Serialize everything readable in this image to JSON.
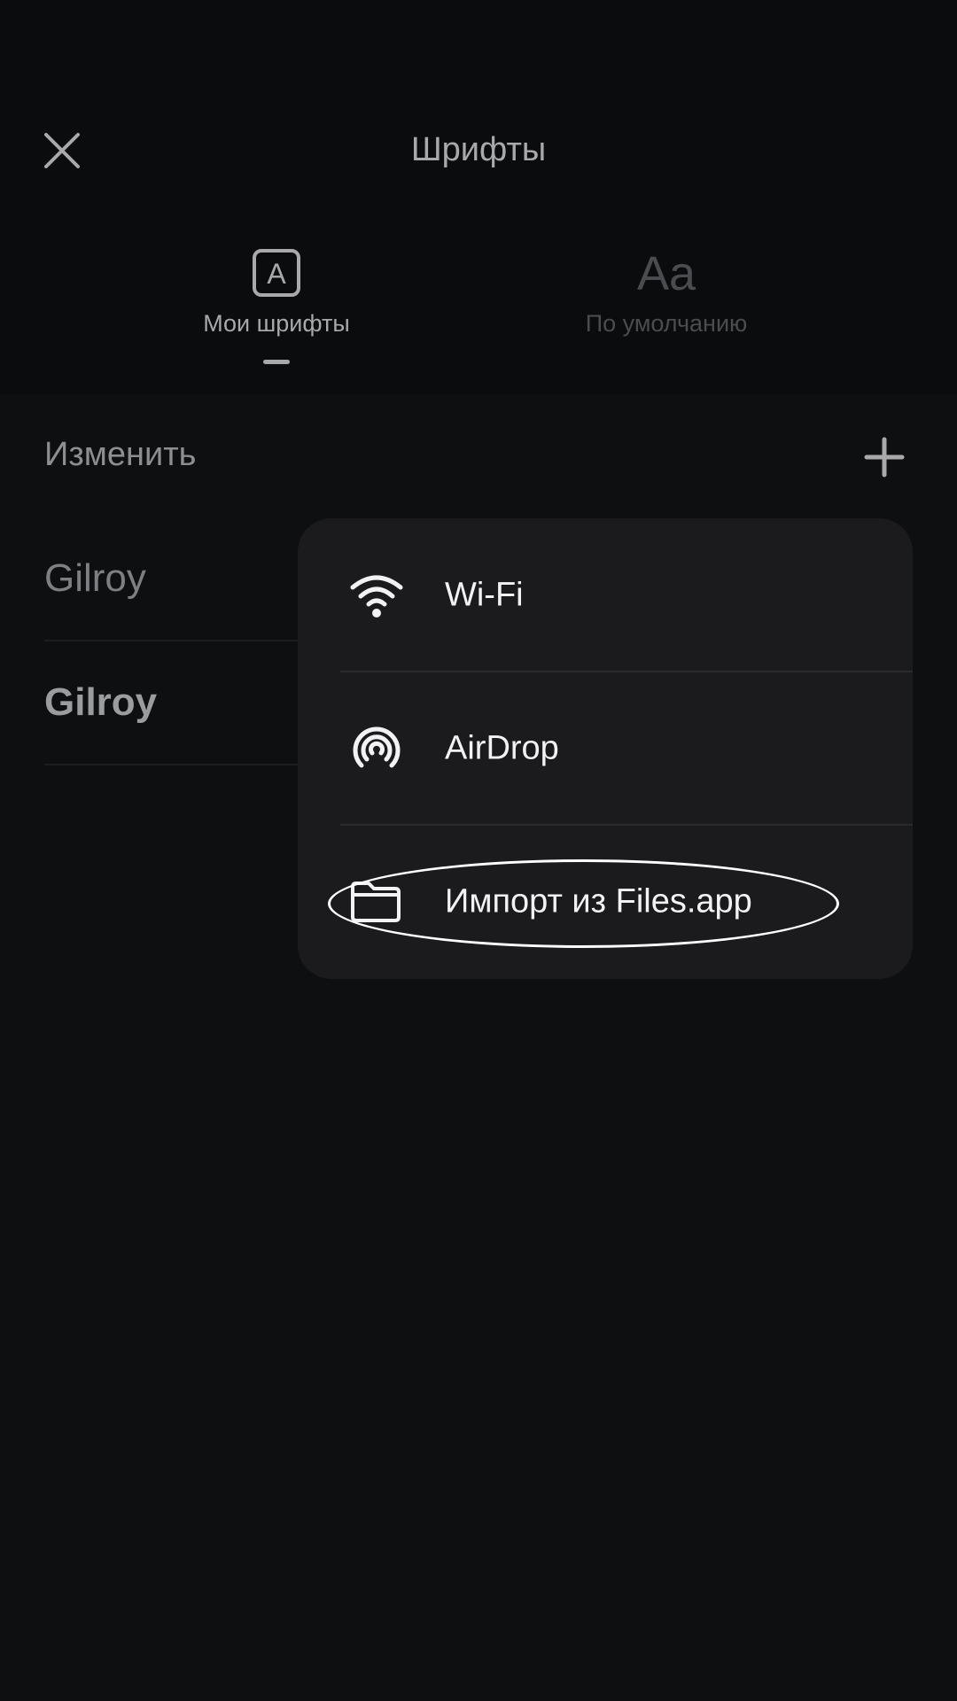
{
  "header": {
    "title": "Шрифты",
    "close_icon": "close-icon"
  },
  "tabs": [
    {
      "label": "Мои шрифты",
      "icon": "a-box-icon",
      "icon_text": "A",
      "active": true
    },
    {
      "label": "По умолчанию",
      "icon": "aa-icon",
      "icon_text": "Aa",
      "active": false
    }
  ],
  "toolbar": {
    "edit_label": "Изменить",
    "add_icon": "plus-icon"
  },
  "fonts": [
    {
      "name": "Gilroy",
      "weight": "light"
    },
    {
      "name": "Gilroy",
      "weight": "bold"
    }
  ],
  "import_menu": {
    "items": [
      {
        "label": "Wi-Fi",
        "icon": "wifi-icon"
      },
      {
        "label": "AirDrop",
        "icon": "airdrop-icon"
      },
      {
        "label": "Импорт из Files.app",
        "icon": "folder-icon",
        "highlighted": true
      }
    ]
  },
  "colors": {
    "background": "#0e0f11",
    "popup": "#1b1b1d",
    "text_primary": "#f2f2f4",
    "text_secondary": "#a9a9ab",
    "text_dim": "#4b4c4f"
  }
}
